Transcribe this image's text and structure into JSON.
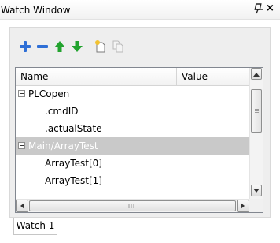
{
  "window": {
    "title": "Watch Window",
    "close_glyph": "×"
  },
  "toolbar": {
    "buttons": [
      {
        "icon": "add-icon",
        "color": "#2f6fd6"
      },
      {
        "icon": "remove-icon",
        "color": "#2f6fd6"
      },
      {
        "icon": "move-up-icon",
        "color": "#22a32e"
      },
      {
        "icon": "move-down-icon",
        "color": "#22a32e"
      },
      {
        "icon": "new-watch-icon",
        "color": "#e0b43c"
      },
      {
        "icon": "copy-icon",
        "color": "#b9b9b9"
      }
    ]
  },
  "grid": {
    "columns": {
      "name": "Name",
      "value": "Value"
    },
    "rows": [
      {
        "name": "PLCopen",
        "value": "",
        "expander": true,
        "level": 0,
        "selected": false
      },
      {
        "name": ".cmdID",
        "value": "",
        "expander": false,
        "level": 1,
        "selected": false
      },
      {
        "name": ".actualState",
        "value": "",
        "expander": false,
        "level": 1,
        "selected": false
      },
      {
        "name": "Main/ArrayTest",
        "value": "",
        "expander": true,
        "level": 0,
        "selected": true
      },
      {
        "name": "ArrayTest[0]",
        "value": "",
        "expander": false,
        "level": 1,
        "selected": false
      },
      {
        "name": "ArrayTest[1]",
        "value": "",
        "expander": false,
        "level": 1,
        "selected": false
      }
    ]
  },
  "tabs": [
    {
      "label": "Watch 1",
      "active": true
    }
  ],
  "colors": {
    "selection": "#c9c9c9",
    "accent_blue": "#2f6fd6",
    "accent_green": "#22a32e"
  }
}
